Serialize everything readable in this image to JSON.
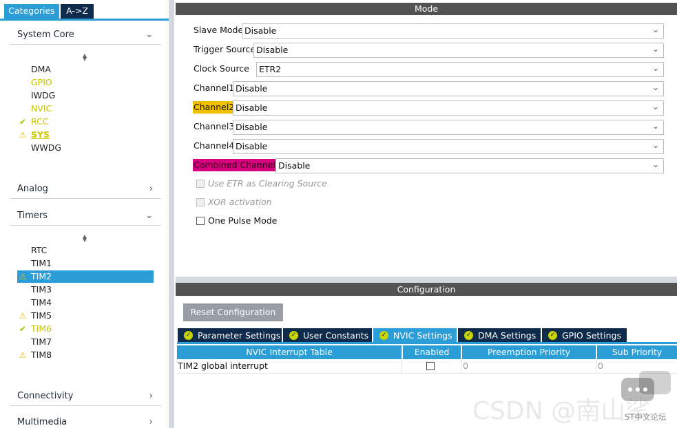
{
  "left_tabs": {
    "categories": "Categories",
    "az": "A->Z"
  },
  "sections": {
    "system_core": "System Core",
    "analog": "Analog",
    "timers": "Timers",
    "connectivity": "Connectivity",
    "multimedia": "Multimedia"
  },
  "system_core_items": [
    "DMA",
    "GPIO",
    "IWDG",
    "NVIC",
    "RCC",
    "SYS",
    "WWDG"
  ],
  "timer_items": [
    "RTC",
    "TIM1",
    "TIM2",
    "TIM3",
    "TIM4",
    "TIM5",
    "TIM6",
    "TIM7",
    "TIM8"
  ],
  "mode": {
    "title": "Mode",
    "fields": [
      {
        "label": "Slave Mode",
        "value": "Disable"
      },
      {
        "label": "Trigger Source",
        "value": "Disable"
      },
      {
        "label": "Clock Source",
        "value": "ETR2"
      },
      {
        "label": "Channel1",
        "value": "Disable"
      },
      {
        "label": "Channel2",
        "value": "Disable"
      },
      {
        "label": "Channel3",
        "value": "Disable"
      },
      {
        "label": "Channel4",
        "value": "Disable"
      },
      {
        "label": "Combined Channels",
        "value": "Disable"
      }
    ],
    "checkboxes": [
      {
        "label": "Use ETR as Clearing Source",
        "enabled": false,
        "checked": false
      },
      {
        "label": "XOR activation",
        "enabled": false,
        "checked": false
      },
      {
        "label": "One Pulse Mode",
        "enabled": true,
        "checked": false
      }
    ]
  },
  "configuration": {
    "title": "Configuration",
    "reset_label": "Reset Configuration",
    "tabs": [
      "Parameter Settings",
      "User Constants",
      "NVIC Settings",
      "DMA Settings",
      "GPIO Settings"
    ],
    "active_tab": "NVIC Settings",
    "table": {
      "headers": [
        "NVIC Interrupt Table",
        "Enabled",
        "Preemption Priority",
        "Sub Priority"
      ],
      "rows": [
        {
          "name": "TIM2 global interrupt",
          "enabled": false,
          "preemption": "0",
          "sub": "0"
        }
      ]
    }
  },
  "watermark": {
    "text": "CSDN @南山挲",
    "sub": "ST中文论坛"
  },
  "colors": {
    "accent": "#2b9ed8",
    "navy": "#0f2b4c",
    "warning": "#e2c000",
    "ok": "#9fc400",
    "channel2_highlight": "#f0c000",
    "combined_highlight": "#d8007e"
  }
}
